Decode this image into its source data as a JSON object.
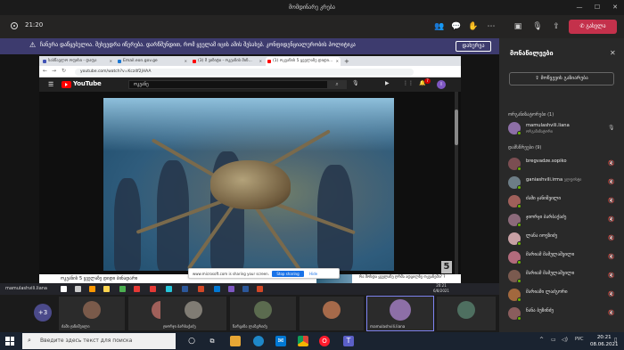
{
  "window": {
    "title": "მომდინარე კრება",
    "controls": [
      "—",
      "☐",
      "✕"
    ]
  },
  "toolbar": {
    "timer": "21:20",
    "leave_label": "გასვლა",
    "icons": [
      "people-icon",
      "chat-icon",
      "reactions-icon",
      "more-icon",
      "camera-icon",
      "mic-icon",
      "share-icon"
    ]
  },
  "banner": {
    "text": "ჩანერა დაწყებულია. შეხვედრა იწერება. დარწმუნდით, რომ ყველამ იცის ამის შესახებ. კონფიდენციალურობის პოლიტიკა",
    "button": "დახურვა"
  },
  "browser": {
    "tabs": [
      {
        "label": "სასწავლო ოფისი - დაფა",
        "color": "#3f51b5"
      },
      {
        "label": "Email.eon.gov.ge",
        "color": "#1976d2"
      },
      {
        "label": "(3) მ ვიზიტი - ოკეანის მინ...",
        "color": "#ff0000"
      },
      {
        "label": "(1) ოკეანის 5 ყველაზე დიდი...",
        "color": "#ff0000"
      }
    ],
    "url": "youtube.com/watch?v=Kcz4f2jHAA"
  },
  "youtube": {
    "brand": "YouTube",
    "search": "ოკეანე",
    "notifications": "7",
    "avatar": "I",
    "watermark": "5",
    "video_title": "ოკეანის 5 ყველაზე დიდი ბინადარი",
    "share_text": "www.microsoft.com is sharing your screen.",
    "share_stop": "Stop sharing",
    "share_hide": "Hide",
    "related": "რა მოხდა ყველაზე ღრმა ადგილზე ოკეანეში? ?"
  },
  "presenter_bar": {
    "name": "mamulashvili.liana",
    "time": "20:21",
    "date": "6/8/2021"
  },
  "gallery": {
    "more": "+3",
    "tiles": [
      {
        "name": "ძამი ჯანიშვილი",
        "color": "#7a5a4a"
      },
      {
        "name": "ჯიორჯი ბარბაქაძე",
        "color": "#807c74"
      },
      {
        "name": "ნარგიზა ლაზგრიძე",
        "color": "#5b6b4f"
      },
      {
        "name": "",
        "color": "#a66a4a"
      },
      {
        "name": "mamulashvili.liana",
        "color": "#8d6fa7"
      },
      {
        "name": "",
        "color": "#4e6f60"
      }
    ]
  },
  "panel": {
    "title": "მონაწილეები",
    "share_invite": "მოწვევის გაზიარება",
    "organizers_header": "ორგანიზატორები (1)",
    "attendees_header": "დამსწრეები (9)",
    "organizers": [
      {
        "name": "mamulashvili.liana",
        "role": "ორგანიზატორი",
        "color": "#8d6fa7"
      }
    ],
    "attendees": [
      {
        "name": "bregvadze.sopiko",
        "color": "#7b4e52"
      },
      {
        "name": "ganiashvili.irma",
        "role": "ელფოსტი",
        "color": "#6d7d86"
      },
      {
        "name": "ძამი ჯანიშვილი",
        "color": "#a0605a"
      },
      {
        "name": "ჯიორჯი ბარბაქაძე",
        "color": "#8c6a7a"
      },
      {
        "name": "ლანა იოეზიძე",
        "color": "#c8a0a4"
      },
      {
        "name": "მარიამ მამულაშვილი",
        "color": "#b26b7c"
      },
      {
        "name": "მარიამ მამულაშვილი",
        "color": "#7a5a4f"
      },
      {
        "name": "მარიამი ლაძგორი",
        "color": "#a2683e"
      },
      {
        "name": "ნანა ბუზინძე",
        "color": "#8a5d5d"
      }
    ]
  },
  "taskbar": {
    "search_placeholder": "Введите здесь текст для поиска",
    "time": "20:21",
    "date": "08.06.2021",
    "lang": "РУС"
  }
}
